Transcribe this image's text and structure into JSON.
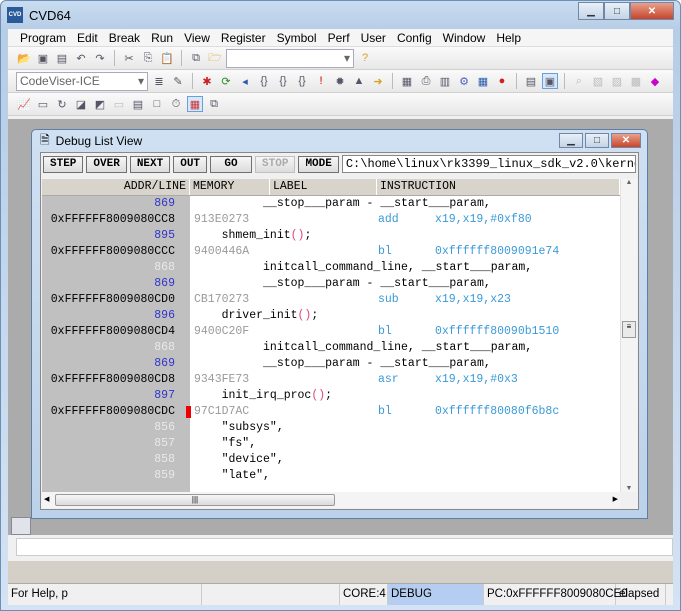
{
  "app": {
    "title": "CVD64",
    "icon_text": "CVD"
  },
  "menu": [
    "Program",
    "Edit",
    "Break",
    "Run",
    "View",
    "Register",
    "Symbol",
    "Perf",
    "User",
    "Config",
    "Window",
    "Help"
  ],
  "toolbar": {
    "target_combo": "CodeViser-ICE",
    "search_combo": ""
  },
  "debug_window": {
    "title": "Debug List View",
    "buttons": [
      "STEP",
      "OVER",
      "NEXT",
      "OUT",
      "GO",
      "STOP",
      "MODE"
    ],
    "disabled_button": "STOP",
    "path": "C:\\home\\linux\\rk3399_linux_sdk_v2.0\\kernel",
    "columns": [
      "ADDR/LINE",
      "MEMORY",
      "LABEL",
      "INSTRUCTION"
    ],
    "rows": [
      {
        "line": "869",
        "active": true,
        "src": "          __stop___param - __start___param,"
      },
      {
        "addr": "0xFFFFFF8009080CC8",
        "mem": "913E0273",
        "mnem": "add",
        "op": "x19,x19,#0xf80"
      },
      {
        "line": "895",
        "active": true,
        "src": "    shmem_init();"
      },
      {
        "addr": "0xFFFFFF8009080CCC",
        "mem": "9400446A",
        "mnem": "bl",
        "op": "0xffffff8009091e74"
      },
      {
        "line": "868",
        "active": false,
        "src": "          initcall_command_line, __start___param,"
      },
      {
        "line": "869",
        "active": true,
        "src": "          __stop___param - __start___param,"
      },
      {
        "addr": "0xFFFFFF8009080CD0",
        "mem": "CB170273",
        "mnem": "sub",
        "op": "x19,x19,x23"
      },
      {
        "line": "896",
        "active": true,
        "src": "    driver_init();"
      },
      {
        "addr": "0xFFFFFF8009080CD4",
        "mem": "9400C20F",
        "mnem": "bl",
        "op": "0xffffff80090b1510"
      },
      {
        "line": "868",
        "active": false,
        "src": "          initcall_command_line, __start___param,"
      },
      {
        "line": "869",
        "active": true,
        "src": "          __stop___param - __start___param,"
      },
      {
        "addr": "0xFFFFFF8009080CD8",
        "mem": "9343FE73",
        "mnem": "asr",
        "op": "x19,x19,#0x3"
      },
      {
        "line": "897",
        "active": true,
        "src": "    init_irq_proc();"
      },
      {
        "addr": "0xFFFFFF8009080CDC",
        "mem": "97C1D7AC",
        "mnem": "bl",
        "op": "0xffffff80080f6b8c",
        "breakpoint": true
      },
      {
        "line": "856",
        "active": false,
        "src": "    \"subsys\","
      },
      {
        "line": "857",
        "active": false,
        "src": "    \"fs\","
      },
      {
        "line": "858",
        "active": false,
        "src": "    \"device\","
      },
      {
        "line": "859",
        "active": false,
        "src": "    \"late\","
      }
    ]
  },
  "status": {
    "help": "For Help, p",
    "core": "CORE:4",
    "mode": "DEBUG",
    "pc": "PC:0xFFFFFF8009080CE0",
    "elapsed": "elapsed"
  },
  "colors": {
    "line_active": "#3333cc",
    "line_inactive": "#e8e8e8",
    "asm": "#3a9ad8",
    "memory": "#9a9a9a",
    "paren": "#e0457b",
    "breakpoint": "#ee0000",
    "status_debug": "#b4cdf0"
  }
}
